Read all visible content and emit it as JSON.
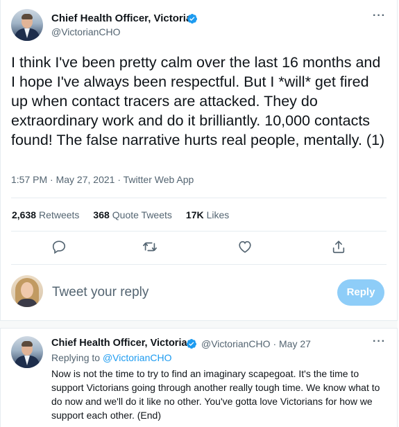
{
  "tweet": {
    "author_name": "Chief Health Officer, Victoria",
    "author_handle": "@VictorianCHO",
    "more_glyph": "···",
    "text": "I think I've been pretty calm over the last 16 months and I hope I've always been respectful. But I *will* get fired up when contact tracers are attacked. They do extraordinary work and do it brilliantly. 10,000 contacts found! The false narrative hurts real people, mentally. (1)",
    "time": "1:57 PM",
    "date": "May 27, 2021",
    "source": "Twitter Web App",
    "separator": "·",
    "stats": {
      "retweets_count": "2,638",
      "retweets_label": "Retweets",
      "quotes_count": "368",
      "quotes_label": "Quote Tweets",
      "likes_count": "17K",
      "likes_label": "Likes"
    }
  },
  "actions": [
    "reply-icon",
    "retweet-icon",
    "like-icon",
    "share-icon"
  ],
  "composer": {
    "placeholder": "Tweet your reply",
    "button_label": "Reply"
  },
  "reply_tweet": {
    "author_name": "Chief Health Officer, Victoria",
    "author_handle": "@VictorianCHO",
    "separator": "·",
    "date": "May 27",
    "more_glyph": "···",
    "replying_prefix": "Replying to",
    "replying_handle": "@VictorianCHO",
    "text": "Now is not the time to try to find an imaginary scapegoat. It's the time to support Victorians going through another really tough time. We know what to do now and we'll do it like no other. You've gotta love Victorians for how we support each other. (End)"
  },
  "colors": {
    "accent": "#1d9bf0",
    "reply_button_disabled": "#8ecdf8",
    "text_primary": "#0f1419",
    "text_secondary": "#536471"
  }
}
